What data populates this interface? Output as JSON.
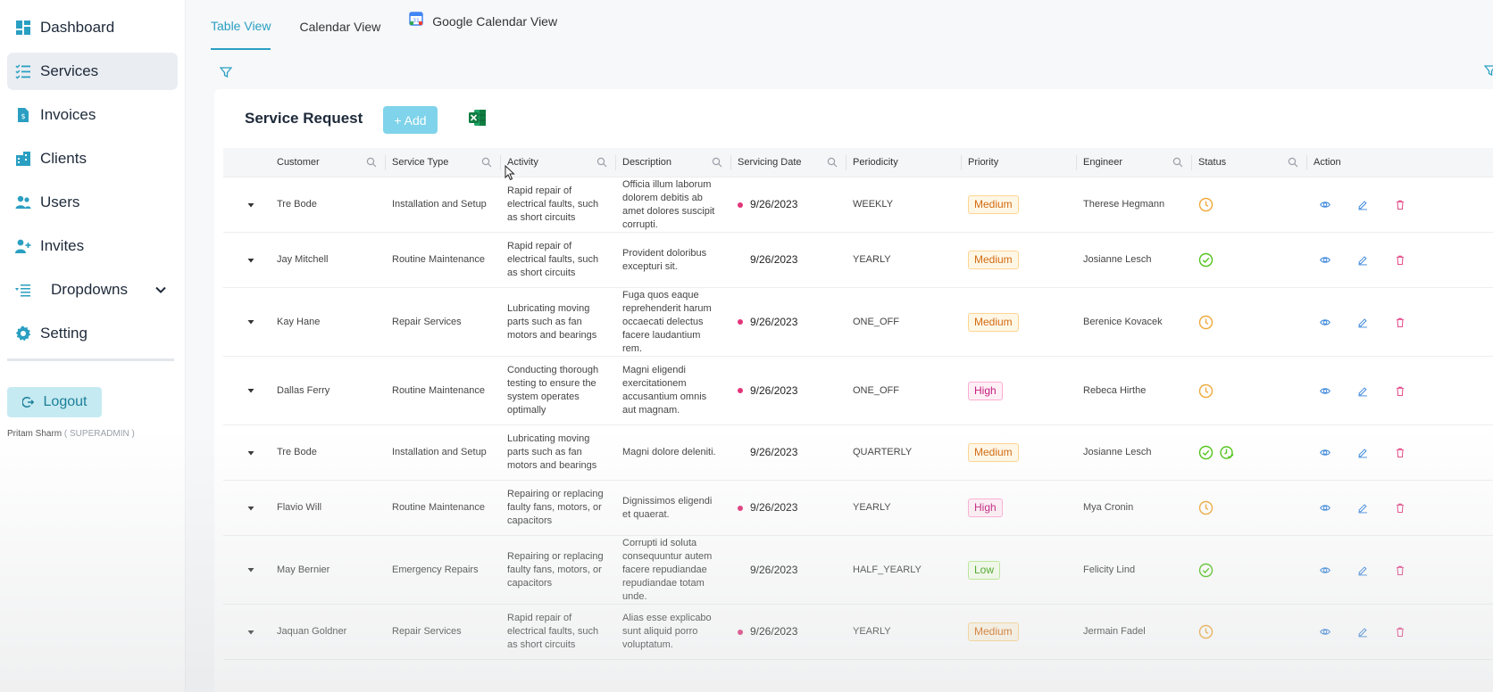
{
  "sidebar": {
    "items": [
      {
        "label": "Dashboard",
        "icon": "dashboard-icon"
      },
      {
        "label": "Services",
        "icon": "list-check-icon"
      },
      {
        "label": "Invoices",
        "icon": "invoice-icon"
      },
      {
        "label": "Clients",
        "icon": "building-icon"
      },
      {
        "label": "Users",
        "icon": "users-icon"
      },
      {
        "label": "Invites",
        "icon": "user-plus-icon"
      },
      {
        "label": "Dropdowns",
        "icon": "dropdown-list-icon"
      },
      {
        "label": "Setting",
        "icon": "gear-icon"
      }
    ],
    "active": "Services",
    "logout_label": "Logout",
    "user_name": "Pritam Sharm",
    "user_role": "( SUPERADMIN )"
  },
  "tabs": [
    {
      "label": "Table View"
    },
    {
      "label": "Calendar View"
    },
    {
      "label": "Google Calendar View"
    }
  ],
  "card": {
    "title": "Service Request",
    "add_label": "+ Add"
  },
  "table": {
    "columns": [
      "Customer",
      "Service Type",
      "Activity",
      "Description",
      "Servicing Date",
      "Periodicity",
      "Priority",
      "Engineer",
      "Status",
      "Action"
    ],
    "rows": [
      {
        "customer": "Tre Bode",
        "service_type": "Installation and Setup",
        "activity": "Rapid repair of electrical faults, such as short circuits",
        "description": "Officia illum laborum dolorem debitis ab amet dolores suscipit corrupti.",
        "date": "9/26/2023",
        "dot": true,
        "periodicity": "WEEKLY",
        "priority": "Medium",
        "engineer": "Therese Hegmann",
        "status": [
          "clock"
        ]
      },
      {
        "customer": "Jay Mitchell",
        "service_type": "Routine Maintenance",
        "activity": "Rapid repair of electrical faults, such as short circuits",
        "description": "Provident doloribus excepturi sit.",
        "date": "9/26/2023",
        "dot": false,
        "periodicity": "YEARLY",
        "priority": "Medium",
        "engineer": "Josianne Lesch",
        "status": [
          "check"
        ]
      },
      {
        "customer": "Kay Hane",
        "service_type": "Repair Services",
        "activity": "Lubricating moving parts such as fan motors and bearings",
        "description": "Fuga quos eaque reprehenderit harum occaecati delectus facere laudantium rem.",
        "date": "9/26/2023",
        "dot": true,
        "periodicity": "ONE_OFF",
        "priority": "Medium",
        "engineer": "Berenice Kovacek",
        "status": [
          "clock"
        ]
      },
      {
        "customer": "Dallas Ferry",
        "service_type": "Routine Maintenance",
        "activity": "Conducting thorough testing to ensure the system operates optimally",
        "description": "Magni eligendi exercitationem accusantium omnis aut magnam.",
        "date": "9/26/2023",
        "dot": true,
        "periodicity": "ONE_OFF",
        "priority": "High",
        "engineer": "Rebeca Hirthe",
        "status": [
          "clock"
        ]
      },
      {
        "customer": "Tre Bode",
        "service_type": "Installation and Setup",
        "activity": "Lubricating moving parts such as fan motors and bearings",
        "description": "Magni dolore deleniti.",
        "date": "9/26/2023",
        "dot": false,
        "periodicity": "QUARTERLY",
        "priority": "Medium",
        "engineer": "Josianne Lesch",
        "status": [
          "check",
          "clock-check"
        ]
      },
      {
        "customer": "Flavio Will",
        "service_type": "Routine Maintenance",
        "activity": "Repairing or replacing faulty fans, motors, or capacitors",
        "description": "Dignissimos eligendi et quaerat.",
        "date": "9/26/2023",
        "dot": true,
        "periodicity": "YEARLY",
        "priority": "High",
        "engineer": "Mya Cronin",
        "status": [
          "clock"
        ]
      },
      {
        "customer": "May Bernier",
        "service_type": "Emergency Repairs",
        "activity": "Repairing or replacing faulty fans, motors, or capacitors",
        "description": "Corrupti id soluta consequuntur autem facere repudiandae repudiandae totam unde.",
        "date": "9/26/2023",
        "dot": false,
        "periodicity": "HALF_YEARLY",
        "priority": "Low",
        "engineer": "Felicity Lind",
        "status": [
          "check"
        ]
      },
      {
        "customer": "Jaquan Goldner",
        "service_type": "Repair Services",
        "activity": "Rapid repair of electrical faults, such as short circuits",
        "description": "Alias esse explicabo sunt aliquid porro voluptatum.",
        "date": "9/26/2023",
        "dot": true,
        "periodicity": "YEARLY",
        "priority": "Medium",
        "engineer": "Jermain Fadel",
        "status": [
          "clock"
        ]
      }
    ]
  },
  "colors": {
    "accent": "#2a9fc2",
    "logout_bg": "#c6eaf2",
    "add_bg": "#7fd3ea",
    "date_dot": "#e2357a",
    "status_clock": "#f0a93b",
    "status_check": "#52c41a",
    "view_icon": "#2f7fd8",
    "delete_icon": "#e2357a"
  }
}
